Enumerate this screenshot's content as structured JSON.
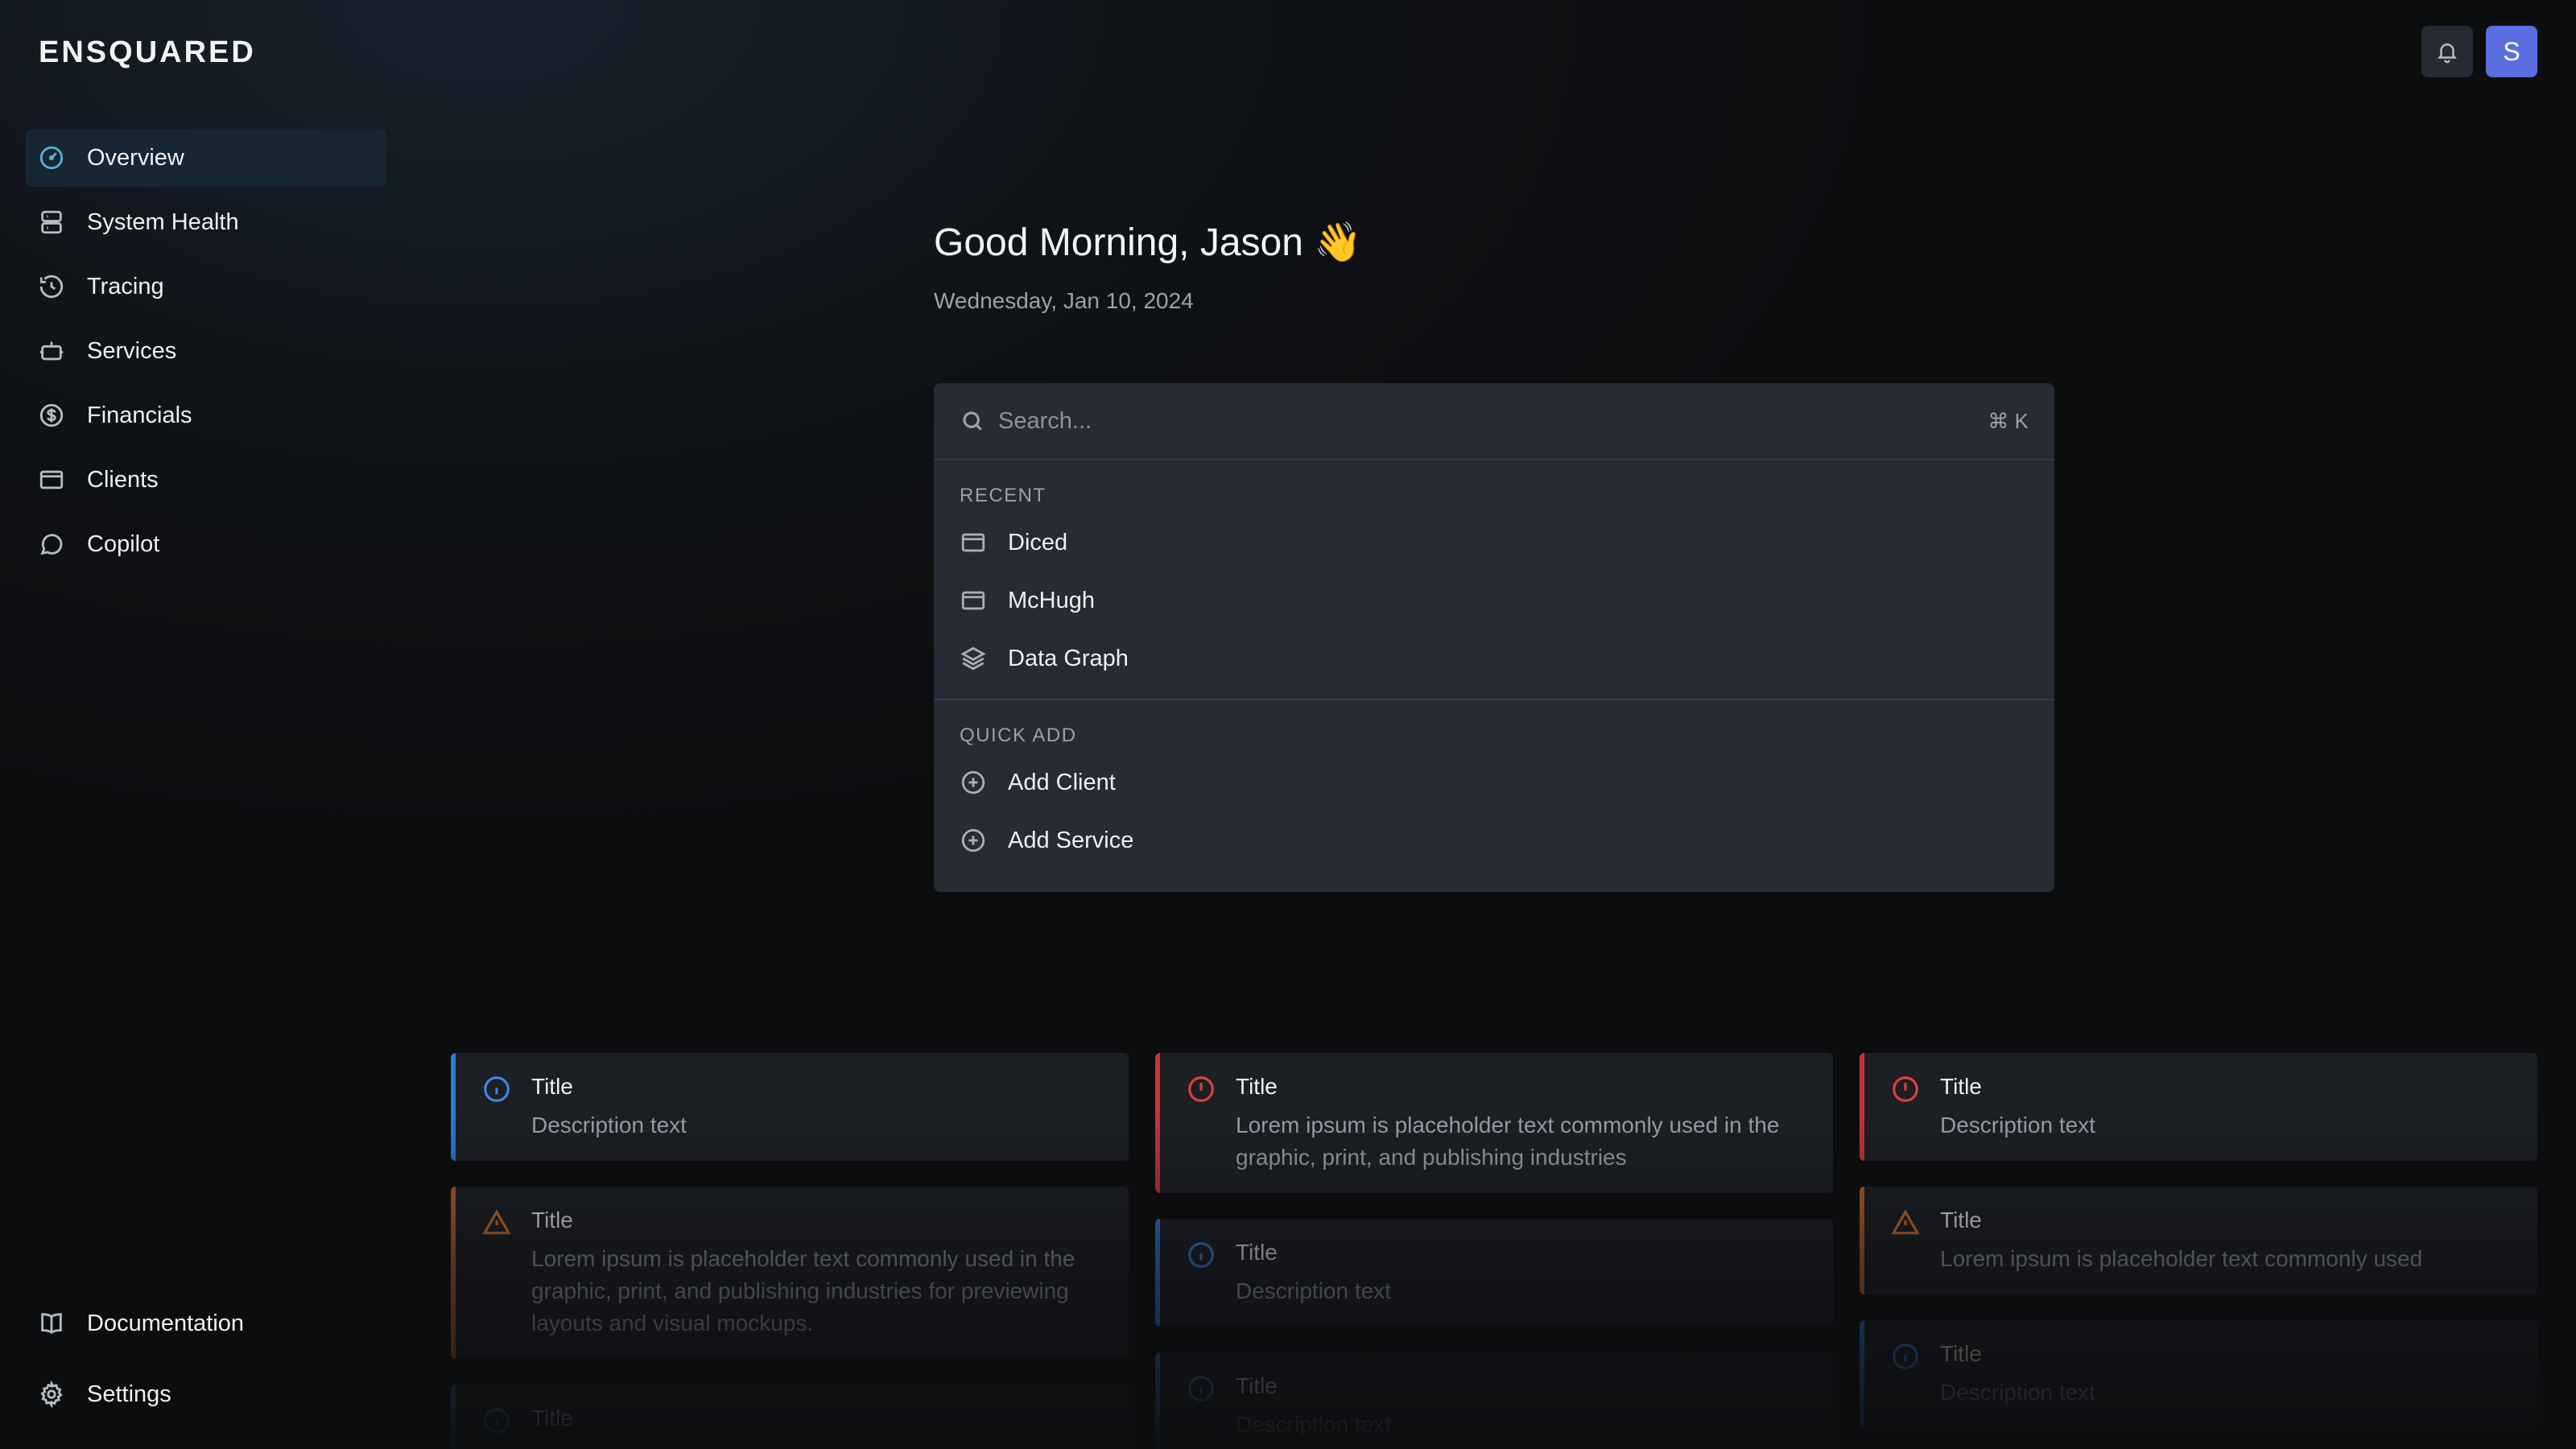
{
  "app": {
    "logo": "ENSQUARED"
  },
  "sidebar": {
    "items": [
      {
        "label": "Overview",
        "icon": "gauge-icon",
        "active": true
      },
      {
        "label": "System Health",
        "icon": "server-icon"
      },
      {
        "label": "Tracing",
        "icon": "history-icon"
      },
      {
        "label": "Services",
        "icon": "bot-icon"
      },
      {
        "label": "Financials",
        "icon": "dollar-circle-icon"
      },
      {
        "label": "Clients",
        "icon": "window-icon"
      },
      {
        "label": "Copilot",
        "icon": "chat-icon"
      }
    ],
    "bottom": [
      {
        "label": "Documentation",
        "icon": "book-icon"
      },
      {
        "label": "Settings",
        "icon": "gear-icon"
      }
    ]
  },
  "header": {
    "avatar_initial": "S",
    "bell_icon": "bell-icon"
  },
  "greeting": {
    "text": "Good Morning, Jason 👋",
    "date": "Wednesday, Jan 10, 2024"
  },
  "palette": {
    "search_placeholder": "Search...",
    "shortcut": "⌘ K",
    "recent_label": "RECENT",
    "recent": [
      {
        "label": "Diced",
        "icon": "window-icon"
      },
      {
        "label": "McHugh",
        "icon": "window-icon"
      },
      {
        "label": "Data Graph",
        "icon": "layers-icon"
      }
    ],
    "quick_add_label": "QUICK ADD",
    "quick_add": [
      {
        "label": "Add Client",
        "icon": "plus-circle-icon"
      },
      {
        "label": "Add Service",
        "icon": "plus-circle-icon"
      }
    ]
  },
  "cards": {
    "col1": [
      {
        "type": "info",
        "title": "Title",
        "desc": "Description text"
      },
      {
        "type": "warn",
        "title": "Title",
        "desc": "Lorem ipsum is placeholder text commonly used in the graphic, print, and publishing industries for previewing layouts and visual mockups."
      },
      {
        "type": "info",
        "title": "Title",
        "desc": ""
      }
    ],
    "col2": [
      {
        "type": "error",
        "title": "Title",
        "desc": "Lorem ipsum is placeholder text commonly used in the graphic, print, and publishing industries"
      },
      {
        "type": "info",
        "title": "Title",
        "desc": "Description text"
      },
      {
        "type": "info",
        "title": "Title",
        "desc": "Description text"
      }
    ],
    "col3": [
      {
        "type": "error",
        "title": "Title",
        "desc": "Description text"
      },
      {
        "type": "warn",
        "title": "Title",
        "desc": "Lorem ipsum is placeholder text commonly used"
      },
      {
        "type": "info",
        "title": "Title",
        "desc": "Description text"
      }
    ]
  },
  "colors": {
    "accent": "#5ab0d8",
    "avatar": "#5b6ee1",
    "info": "#2f7ad4",
    "error": "#c6343a",
    "warn": "#b8652a"
  }
}
